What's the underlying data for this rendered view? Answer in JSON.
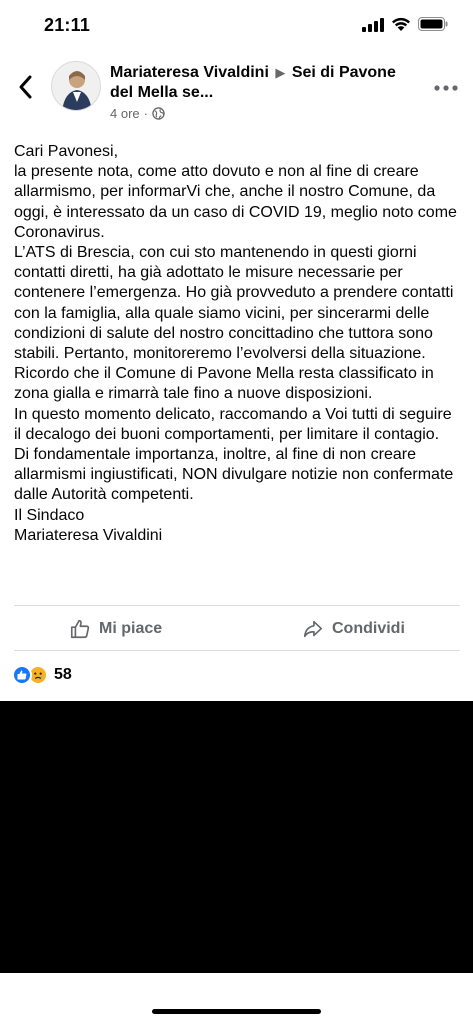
{
  "status_bar": {
    "time": "21:11"
  },
  "header": {
    "author": "Mariateresa Vivaldini",
    "separator_icon": "triangle-right-icon",
    "group": "Sei di Pavone del Mella se...",
    "timestamp": "4 ore",
    "dot": "·",
    "privacy_icon": "globe-icon"
  },
  "post": {
    "paragraphs": [
      "Cari Pavonesi,\nla presente nota, come atto dovuto e non al fine di creare allarmismo, per informarVi che, anche il nostro Comune, da oggi, è interessato da un caso di COVID 19, meglio noto come Coronavirus.",
      "L’ATS di Brescia, con cui sto mantenendo in questi giorni contatti diretti, ha già adottato le misure necessarie per contenere l’emergenza. Ho già provveduto a prendere contatti con la famiglia, alla quale siamo vicini, per sincerarmi delle condizioni di salute del nostro concittadino che tuttora sono stabili. Pertanto, monitoreremo l’evolversi della situazione. Ricordo che il Comune di Pavone Mella resta classificato in zona gialla e rimarrà tale fino a nuove disposizioni.",
      "In questo momento delicato, raccomando a Voi tutti di seguire il decalogo dei buoni comportamenti, per limitare il contagio.",
      "Di fondamentale importanza, inoltre, al fine di non creare allarmismi ingiustificati, NON divulgare notizie non confermate dalle Autorità competenti.",
      "Il Sindaco",
      "Mariateresa Vivaldini"
    ]
  },
  "actions": {
    "like_label": "Mi piace",
    "share_label": "Condividi"
  },
  "reactions": {
    "count": "58"
  },
  "colors": {
    "brand_blue": "#1877f2",
    "secondary_text": "#65676b",
    "divider": "#dadde1",
    "sad_yellow": "#f7b125"
  }
}
